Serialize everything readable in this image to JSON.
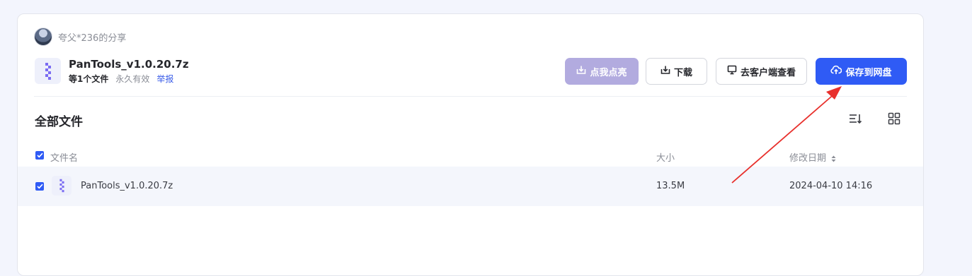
{
  "share": {
    "sharer_name": "夸父*236的分享",
    "file_title": "PanTools_v1.0.20.7z",
    "file_count": "等1个文件",
    "validity": "永久有效",
    "report": "举报"
  },
  "actions": {
    "highlight": "点我点亮",
    "download": "下载",
    "open_client": "去客户端查看",
    "save_to_disk": "保存到网盘"
  },
  "section": {
    "title": "全部文件"
  },
  "table": {
    "columns": {
      "name": "文件名",
      "size": "大小",
      "modified": "修改日期"
    },
    "rows": [
      {
        "name": "PanTools_v1.0.20.7z",
        "size": "13.5M",
        "modified": "2024-04-10 14:16",
        "checked": true
      }
    ]
  },
  "icons": {
    "file": "zip-file-icon",
    "sort": "sort-list-icon",
    "grid": "grid-view-icon",
    "download": "download-icon",
    "monitor": "monitor-icon",
    "upload": "cloud-upload-icon"
  },
  "colors": {
    "primary": "#2f5bf5",
    "light_button": "#b2abdf",
    "annotation_arrow": "#e8302c"
  }
}
